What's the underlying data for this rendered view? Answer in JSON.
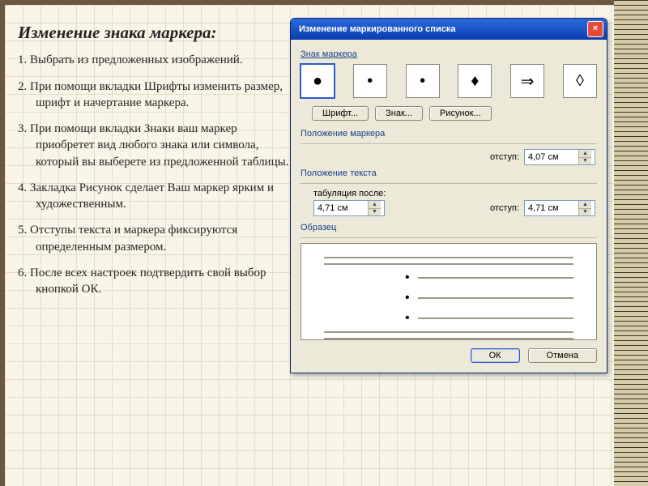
{
  "left": {
    "heading": "Изменение знака маркера:",
    "items": [
      "1. Выбрать из предложенных изображений.",
      "2. При помощи вкладки Шрифты изменить размер, шрифт и начертание маркера.",
      "3. При помощи вкладки Знаки ваш маркер приобретет вид любого знака или символа, который вы выберете из предложенной таблицы.",
      "4. Закладка Рисунок сделает Ваш маркер ярким и художественным.",
      "5. Отступы текста и маркера фиксируются определенным размером.",
      "6. После всех настроек подтвердить свой выбор кнопкой ОК."
    ]
  },
  "dialog": {
    "title": "Изменение маркированного списка",
    "close": "×",
    "group_marker": "Знак маркера",
    "bullets": [
      "●",
      "•",
      "•",
      "♦",
      "⇒",
      "◊"
    ],
    "selected_bullet_index": 0,
    "btn_font": "Шрифт...",
    "btn_char": "Знак...",
    "btn_picture": "Рисунок...",
    "group_marker_pos": "Положение маркера",
    "label_indent": "отступ:",
    "marker_indent_value": "4,07 см",
    "group_text_pos": "Положение текста",
    "label_tab_after": "табуляция после:",
    "tab_after_value": "4,71 см",
    "text_indent_value": "4,71 см",
    "group_preview": "Образец",
    "ok": "ОК",
    "cancel": "Отмена"
  }
}
